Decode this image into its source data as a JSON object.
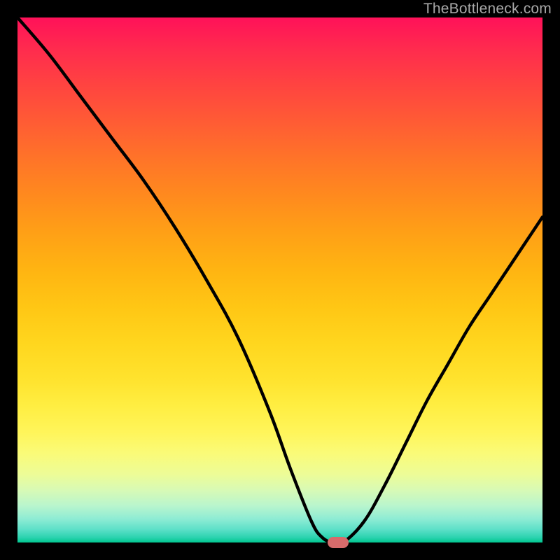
{
  "watermark": "TheBottleneck.com",
  "chart_data": {
    "type": "line",
    "title": "",
    "xlabel": "",
    "ylabel": "",
    "xlim": [
      0,
      100
    ],
    "ylim": [
      0,
      100
    ],
    "series": [
      {
        "name": "bottleneck-curve",
        "x": [
          0,
          6,
          12,
          18,
          24,
          30,
          36,
          42,
          48,
          52,
          56,
          58,
          60,
          62,
          66,
          70,
          74,
          78,
          82,
          86,
          90,
          94,
          100
        ],
        "values": [
          100,
          93,
          85,
          77,
          69,
          60,
          50,
          39,
          25,
          14,
          4,
          1,
          0,
          0,
          4,
          11,
          19,
          27,
          34,
          41,
          47,
          53,
          62
        ]
      }
    ],
    "min_marker": {
      "x": 61,
      "y": 0
    },
    "gradient_stops": [
      {
        "pct": 0,
        "color": "#ff1159"
      },
      {
        "pct": 50,
        "color": "#ffc614"
      },
      {
        "pct": 80,
        "color": "#fff55a"
      },
      {
        "pct": 100,
        "color": "#00c890"
      }
    ]
  }
}
